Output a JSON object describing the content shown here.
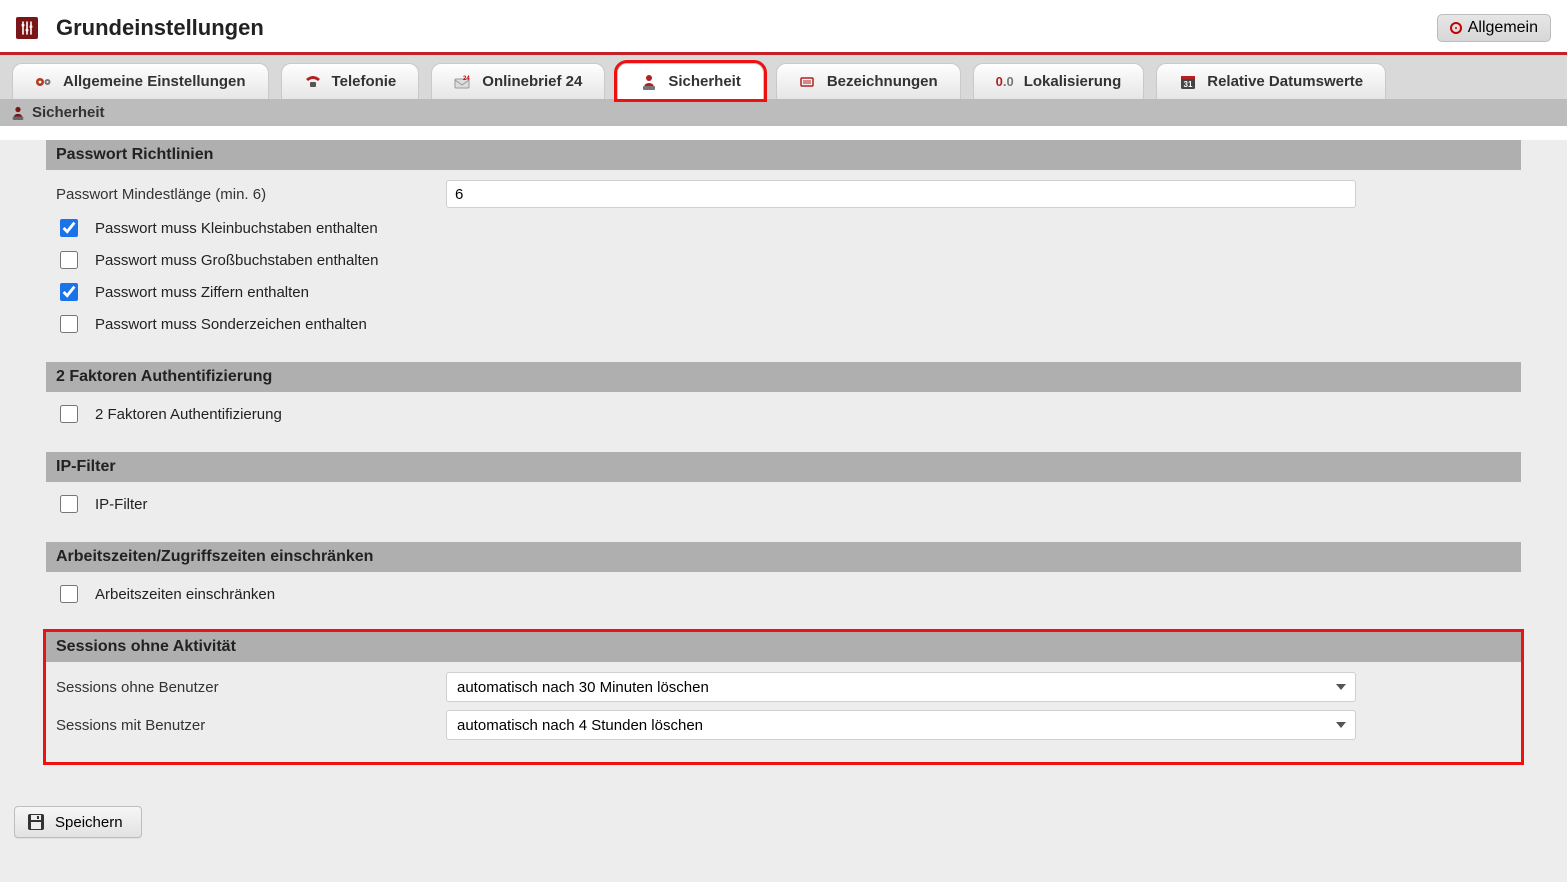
{
  "header": {
    "title": "Grundeinstellungen",
    "allgemein_label": "Allgemein"
  },
  "tabs": [
    {
      "id": "general",
      "label": "Allgemeine Einstellungen",
      "icon": "gears-icon"
    },
    {
      "id": "telefonie",
      "label": "Telefonie",
      "icon": "phone-icon"
    },
    {
      "id": "onlinebrief",
      "label": "Onlinebrief 24",
      "icon": "mail24-icon"
    },
    {
      "id": "sicherheit",
      "label": "Sicherheit",
      "icon": "security-icon",
      "active": true
    },
    {
      "id": "bez",
      "label": "Bezeichnungen",
      "icon": "tags-icon"
    },
    {
      "id": "lok",
      "label": "Lokalisierung",
      "icon": "decimal-icon"
    },
    {
      "id": "reldate",
      "label": "Relative Datumswerte",
      "icon": "calendar-icon"
    }
  ],
  "subheader": {
    "label": "Sicherheit"
  },
  "sections": {
    "pw": {
      "title": "Passwort Richtlinien",
      "min_len_label": "Passwort Mindestlänge (min. 6)",
      "min_len_value": "6",
      "rule_lower": {
        "label": "Passwort muss Kleinbuchstaben enthalten",
        "checked": true
      },
      "rule_upper": {
        "label": "Passwort muss Großbuchstaben enthalten",
        "checked": false
      },
      "rule_digits": {
        "label": "Passwort muss Ziffern enthalten",
        "checked": true
      },
      "rule_special": {
        "label": "Passwort muss Sonderzeichen enthalten",
        "checked": false
      }
    },
    "mfa": {
      "title": "2 Faktoren Authentifizierung",
      "opt": {
        "label": "2 Faktoren Authentifizierung",
        "checked": false
      }
    },
    "ipfilter": {
      "title": "IP-Filter",
      "opt": {
        "label": "IP-Filter",
        "checked": false
      }
    },
    "worktime": {
      "title": "Arbeitszeiten/Zugriffszeiten einschränken",
      "opt": {
        "label": "Arbeitszeiten einschränken",
        "checked": false
      }
    },
    "sessions": {
      "title": "Sessions ohne Aktivität",
      "no_user": {
        "label": "Sessions ohne Benutzer",
        "value": "automatisch nach 30 Minuten löschen"
      },
      "with_user": {
        "label": "Sessions mit Benutzer",
        "value": "automatisch nach 4 Stunden löschen"
      }
    }
  },
  "footer": {
    "save_label": "Speichern"
  }
}
